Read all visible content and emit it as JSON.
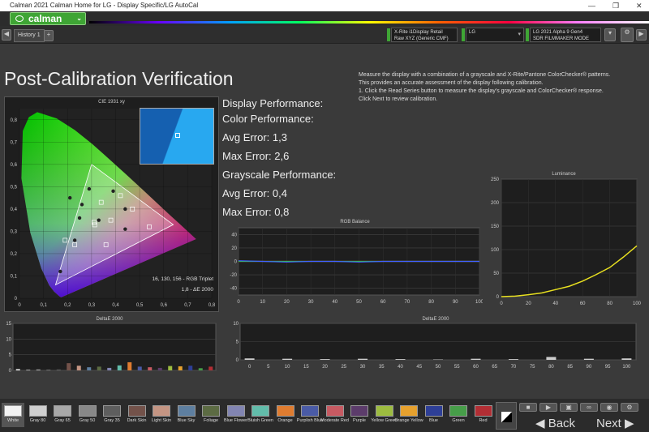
{
  "window": {
    "title": "Calman 2021 Calman Home for LG - Display Specific/LG AutoCal",
    "min": "—",
    "max": "❐",
    "close": "✕"
  },
  "brand": {
    "logo": "calman"
  },
  "toolbar": {
    "history_tab": "History 1",
    "meter": {
      "line1": "X-Rite i1Display Retail",
      "line2": "Raw XYZ (Generic CMF)"
    },
    "source": {
      "line1": "LG"
    },
    "display": {
      "line1": "LG 2021 Alpha 9 Gen4",
      "line2": "SDR FILMMAKER MODE"
    }
  },
  "page": {
    "title": "Post-Calibration Verification",
    "instructions": [
      "Measure the display with a combination of a grayscale and X-Rite/Pantone ColorChecker® patterns.",
      "This provides an accurate assessment of the display following calibration.",
      "1. Click the Read Series button to measure the display's grayscale and ColorChecker® response.",
      "Click Next to review calibration."
    ]
  },
  "performance": {
    "display": "Display Performance:",
    "color": "Color Performance:",
    "color_avg": "Avg Error: 1,3",
    "color_max": "Max Error: 2,6",
    "gray": "Grayscale Performance:",
    "gray_avg": "Avg Error: 0,4",
    "gray_max": "Max Error: 0,8"
  },
  "cie": {
    "title": "CIE 1931 xy",
    "rgb_triplet": "16, 130, 156 - RGB Triplet",
    "de_value": "1,8 - ΔE 2000",
    "x_ticks": [
      "0",
      "0,1",
      "0,2",
      "0,3",
      "0,4",
      "0,5",
      "0,6",
      "0,7",
      "0,8"
    ],
    "y_ticks": [
      "0,8",
      "0,7",
      "0,6",
      "0,5",
      "0,4",
      "0,3",
      "0,2",
      "0,1",
      "0"
    ]
  },
  "rgb_balance": {
    "title": "RGB Balance",
    "y_ticks": [
      "40",
      "20",
      "0",
      "-20",
      "-40"
    ],
    "x_ticks": [
      "0",
      "10",
      "20",
      "30",
      "40",
      "50",
      "60",
      "70",
      "80",
      "90",
      "100"
    ]
  },
  "luminance": {
    "title": "Luminance",
    "y_ticks": [
      "250",
      "200",
      "150",
      "100",
      "50",
      "0"
    ],
    "x_ticks": [
      "0",
      "20",
      "40",
      "60",
      "80",
      "100"
    ]
  },
  "deltae_left": {
    "title": "DeltaE 2000",
    "y_ticks": [
      "15",
      "10",
      "5",
      "0"
    ]
  },
  "deltae_right": {
    "title": "DeltaE 2000",
    "y_ticks": [
      "10",
      "5",
      "0"
    ],
    "x_ticks": [
      "0",
      "5",
      "10",
      "15",
      "20",
      "25",
      "30",
      "35",
      "40",
      "45",
      "50",
      "55",
      "60",
      "65",
      "70",
      "75",
      "80",
      "85",
      "90",
      "95",
      "100"
    ]
  },
  "chart_data": [
    {
      "type": "scatter",
      "title": "CIE 1931 xy",
      "gamut": [
        [
          0.64,
          0.33
        ],
        [
          0.3,
          0.6
        ],
        [
          0.15,
          0.06
        ]
      ],
      "points": [
        [
          0.313,
          0.329
        ],
        [
          0.44,
          0.4
        ],
        [
          0.38,
          0.35
        ],
        [
          0.25,
          0.36
        ],
        [
          0.34,
          0.43
        ],
        [
          0.21,
          0.45
        ],
        [
          0.19,
          0.26
        ],
        [
          0.23,
          0.26
        ],
        [
          0.36,
          0.24
        ],
        [
          0.26,
          0.42
        ],
        [
          0.42,
          0.46
        ],
        [
          0.39,
          0.48
        ],
        [
          0.47,
          0.4
        ],
        [
          0.44,
          0.31
        ],
        [
          0.54,
          0.32
        ],
        [
          0.17,
          0.12
        ],
        [
          0.23,
          0.24
        ],
        [
          0.29,
          0.49
        ],
        [
          0.31,
          0.34
        ],
        [
          0.33,
          0.35
        ]
      ]
    },
    {
      "type": "line",
      "title": "RGB Balance",
      "x": [
        0,
        10,
        20,
        30,
        40,
        50,
        60,
        70,
        80,
        90,
        100
      ],
      "series": [
        {
          "name": "Red",
          "values": [
            0,
            0,
            0,
            0,
            0,
            0,
            0,
            0,
            0,
            0,
            0
          ]
        },
        {
          "name": "Green",
          "values": [
            0,
            0,
            0,
            0,
            0,
            0,
            0,
            0,
            0,
            0,
            0
          ]
        },
        {
          "name": "Blue",
          "values": [
            1,
            0,
            -1,
            0,
            0,
            -1,
            0,
            0,
            0,
            0,
            0
          ]
        }
      ],
      "ylim": [
        -50,
        50
      ]
    },
    {
      "type": "line",
      "title": "Luminance",
      "x": [
        0,
        10,
        20,
        30,
        40,
        50,
        60,
        70,
        80,
        90,
        100
      ],
      "values": [
        0,
        1,
        4,
        8,
        15,
        22,
        33,
        47,
        62,
        84,
        108
      ],
      "ylim": [
        0,
        250
      ]
    },
    {
      "type": "bar",
      "title": "DeltaE 2000",
      "categories": [
        "White",
        "Gray 80",
        "Gray 65",
        "Gray 50",
        "Gray 35",
        "Dark Skin",
        "Light Skin",
        "Blue Sky",
        "Foliage",
        "Blue Flower",
        "Bluish Green",
        "Orange",
        "Purplish Blue",
        "Moderate Red",
        "Purple",
        "Yellow Green",
        "Orange Yellow",
        "Blue",
        "Green",
        "Red"
      ],
      "values": [
        0.4,
        0.2,
        0.3,
        0.2,
        0.3,
        2.3,
        1.5,
        1.0,
        1.2,
        0.8,
        1.6,
        2.6,
        1.2,
        1.0,
        0.8,
        1.4,
        1.3,
        1.5,
        0.7,
        1.2
      ],
      "ylim": [
        0,
        15
      ]
    },
    {
      "type": "bar",
      "title": "DeltaE 2000",
      "x": [
        0,
        10,
        20,
        30,
        40,
        50,
        60,
        70,
        80,
        90,
        100
      ],
      "values": [
        0.4,
        0.3,
        0.2,
        0.3,
        0.2,
        0.1,
        0.3,
        0.2,
        0.8,
        0.3,
        0.4
      ],
      "ylim": [
        0,
        10
      ]
    }
  ],
  "swatches": [
    {
      "label": "White",
      "color": "#f2f2f2",
      "sel": true
    },
    {
      "label": "Gray 80",
      "color": "#cfcfcf"
    },
    {
      "label": "Gray 65",
      "color": "#a8a8a8"
    },
    {
      "label": "Gray 50",
      "color": "#888888"
    },
    {
      "label": "Gray 35",
      "color": "#5e5e5e"
    },
    {
      "label": "Dark Skin",
      "color": "#73524a"
    },
    {
      "label": "Light Skin",
      "color": "#c49583"
    },
    {
      "label": "Blue Sky",
      "color": "#5e7fa0"
    },
    {
      "label": "Foliage",
      "color": "#5c6b43"
    },
    {
      "label": "Blue Flower",
      "color": "#8285b2"
    },
    {
      "label": "Bluish Green",
      "color": "#62bcaa"
    },
    {
      "label": "Orange",
      "color": "#df7c30"
    },
    {
      "label": "Purplish Blue",
      "color": "#4a5ba6"
    },
    {
      "label": "Moderate Red",
      "color": "#c75a62"
    },
    {
      "label": "Purple",
      "color": "#5c3c6b"
    },
    {
      "label": "Yellow Green",
      "color": "#9dbc40"
    },
    {
      "label": "Orange Yellow",
      "color": "#e6a12e"
    },
    {
      "label": "Blue",
      "color": "#2e3f97"
    },
    {
      "label": "Green",
      "color": "#479e49"
    },
    {
      "label": "Red",
      "color": "#b22e34"
    }
  ],
  "nav": {
    "back": "Back",
    "next": "Next"
  }
}
